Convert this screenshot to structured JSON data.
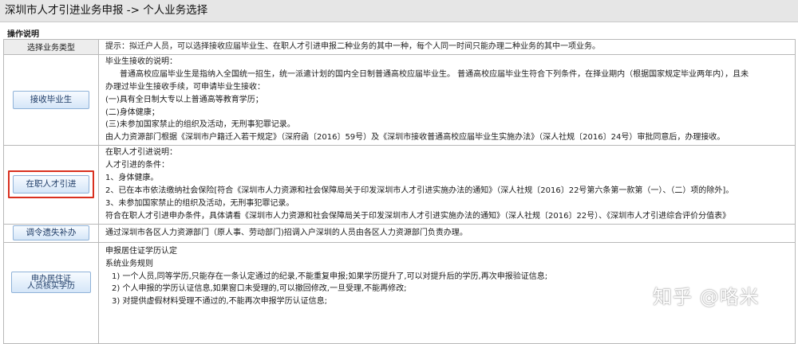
{
  "header": {
    "title": "深圳市人才引进业务申报 -> 个人业务选择",
    "section_label": "操作说明"
  },
  "table": {
    "header_left": "选择业务类型",
    "header_right": "提示：拟迁户人员，可以选择接收应届毕业生、在职人才引进申报二种业务的其中一种，每个人同一时间只能办理二种业务的其中一项业务。"
  },
  "rows": [
    {
      "button": "接收毕业生",
      "lines": [
        "毕业生接收的说明：",
        "普通高校应届毕业生是指纳入全国统一招生，统一派遣计划的国内全日制普通高校应届毕业生。 普通高校应届毕业生符合下列条件，在择业期内（根据国家规定毕业两年内），且未",
        "办理过毕业生接收手续，可申请毕业生接收：",
        "(一)具有全日制大专以上普通高等教育学历；",
        "(二)身体健康；",
        "(三)未参加国家禁止的组织及活动，无刑事犯罪记录。",
        "由人力资源部门根据《深圳市户籍迁入若干规定》（深府函〔2016〕59号）及《深圳市接收普通高校应届毕业生实施办法》（深人社规〔2016〕24号）审批同意后，办理接收。"
      ]
    },
    {
      "button": "在职人才引进",
      "lines": [
        "在职人才引进说明：",
        "人才引进的条件：",
        "1、身体健康。",
        "2、已在本市依法缴纳社会保险[符合《深圳市人力资源和社会保障局关于印发深圳市人才引进实施办法的通知》（深人社规〔2016〕22号第六条第一款第（一）、（二）项的除外]。",
        "3、未参加国家禁止的组织及活动，无刑事犯罪记录。",
        "符合在职人才引进申办条件，具体请看《深圳市人力资源和社会保障局关于印发深圳市人才引进实施办法的通知》（深人社规〔2016〕22号）、《深圳市人才引进综合评价分值表》"
      ]
    },
    {
      "button": "调令遗失补办",
      "lines": [
        "通过深圳市各区人力资源部门（原人事、劳动部门)招调入户深圳的人员由各区人力资源部门负责办理。"
      ]
    },
    {
      "button_line1": "申办居住证",
      "button_line2": "人员核实学历",
      "lines": [
        "申报居住证学历认定",
        "系统业务规则",
        "1) 一个人员,同等学历,只能存在一条认定通过的纪录,不能重复申报;如果学历提升了,可以对提升后的学历,再次申报验证信息;",
        "2) 个人申报的学历认证信息,如果窗口未受理的,可以撤回修改,一旦受理,不能再修改;",
        "3) 对提供虚假材料受理不通过的,不能再次申报学历认证信息;"
      ]
    }
  ],
  "watermark": "知乎 @咯米"
}
